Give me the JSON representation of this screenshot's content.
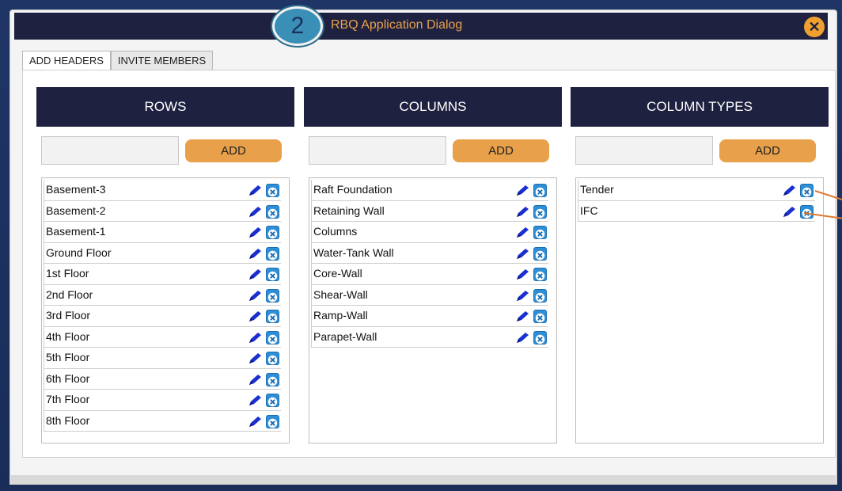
{
  "dialog": {
    "title": "RBQ Application Dialog",
    "step_badge": "2",
    "close_glyph": "✕"
  },
  "tabs": [
    {
      "label": "ADD HEADERS",
      "active": true
    },
    {
      "label": "INVITE MEMBERS",
      "active": false
    }
  ],
  "panels": {
    "rows": {
      "header": "ROWS",
      "add_label": "ADD",
      "items": [
        "Basement-3",
        "Basement-2",
        "Basement-1",
        "Ground Floor",
        "1st Floor",
        "2nd Floor",
        "3rd Floor",
        "4th Floor",
        "5th Floor",
        "6th Floor",
        "7th Floor",
        "8th Floor"
      ]
    },
    "columns": {
      "header": "COLUMNS",
      "add_label": "ADD",
      "items": [
        "Raft Foundation",
        "Retaining Wall",
        "Columns",
        "Water-Tank Wall",
        "Core-Wall",
        "Shear-Wall",
        "Ramp-Wall",
        "Parapet-Wall"
      ]
    },
    "column_types": {
      "header": "COLUMN TYPES",
      "add_label": "ADD",
      "items": [
        "Tender",
        "IFC"
      ]
    }
  },
  "icons": {
    "edit": "pencil-icon",
    "delete": "delete-x-icon",
    "close": "close-icon"
  },
  "colors": {
    "header_bg": "#1e2140",
    "accent_orange": "#e8a04a",
    "delete_blue": "#2f8fd6",
    "edit_blue": "#1a2fd1"
  }
}
